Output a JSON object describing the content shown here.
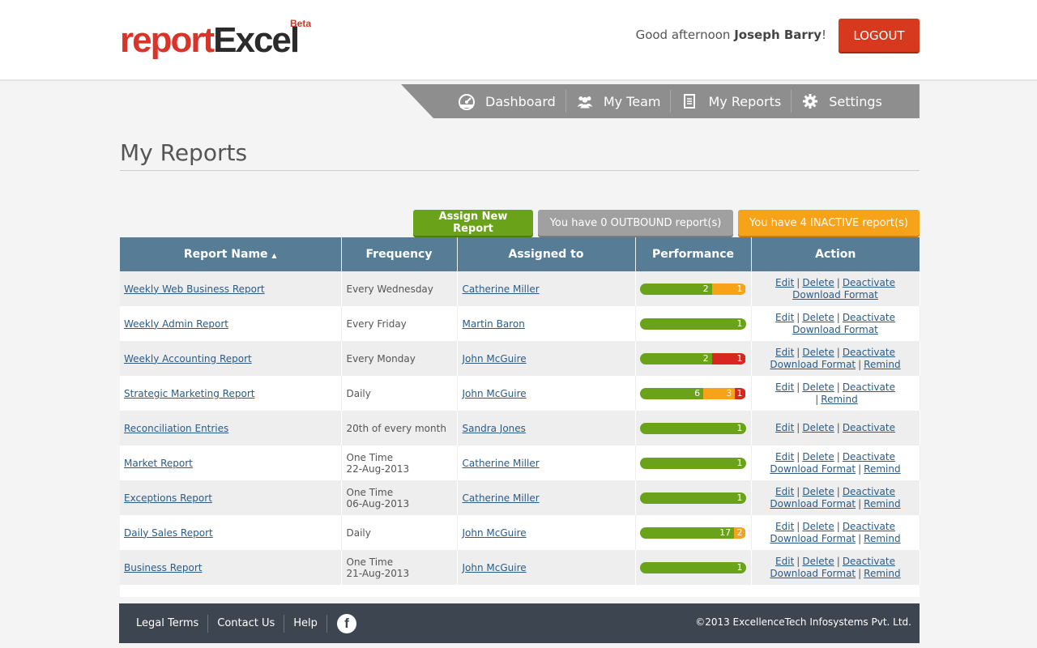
{
  "brand": {
    "part1": "report",
    "part2": "Excel",
    "beta": "Beta"
  },
  "header": {
    "greeting_prefix": "Good afternoon ",
    "user_name": "Joseph Barry",
    "greeting_suffix": "!",
    "logout_label": "LOGOUT"
  },
  "nav": [
    {
      "label": "Dashboard",
      "icon": "speedometer-icon"
    },
    {
      "label": "My Team",
      "icon": "team-icon"
    },
    {
      "label": "My Reports",
      "icon": "reports-icon"
    },
    {
      "label": "Settings",
      "icon": "gear-icon"
    }
  ],
  "page": {
    "title": "My Reports"
  },
  "buttons": {
    "assign": "Assign New Report",
    "outbound": "You have 0 OUTBOUND report(s)",
    "inactive": "You have 4 INACTIVE report(s)"
  },
  "table": {
    "headers": {
      "name": "Report Name",
      "sort_arrow": "▲",
      "frequency": "Frequency",
      "assigned": "Assigned to",
      "performance": "Performance",
      "action": "Action"
    },
    "rows": [
      {
        "name": "Weekly Web Business Report",
        "freq1": "Every Wednesday",
        "freq2": "",
        "assigned": "Catherine Miller",
        "perf": [
          {
            "c": "g",
            "v": "2",
            "w": 68
          },
          {
            "c": "o",
            "v": "1",
            "w": 32
          }
        ],
        "actions": [
          [
            "Edit",
            "Delete",
            "Deactivate"
          ],
          [
            "Download Format"
          ]
        ]
      },
      {
        "name": "Weekly Admin Report",
        "freq1": "Every Friday",
        "freq2": "",
        "assigned": "Martin Baron",
        "perf": [
          {
            "c": "g",
            "v": "1",
            "w": 100
          }
        ],
        "actions": [
          [
            "Edit",
            "Delete",
            "Deactivate"
          ],
          [
            "Download Format"
          ]
        ]
      },
      {
        "name": "Weekly Accounting Report",
        "freq1": "Every Monday",
        "freq2": "",
        "assigned": "John McGuire",
        "perf": [
          {
            "c": "g",
            "v": "2",
            "w": 68
          },
          {
            "c": "r",
            "v": "1",
            "w": 32
          }
        ],
        "actions": [
          [
            "Edit",
            "Delete",
            "Deactivate"
          ],
          [
            "Download Format",
            "Remind"
          ]
        ]
      },
      {
        "name": "Strategic Marketing Report",
        "freq1": "Daily",
        "freq2": "",
        "assigned": "John McGuire",
        "perf": [
          {
            "c": "g",
            "v": "6",
            "w": 60
          },
          {
            "c": "o",
            "v": "3",
            "w": 30
          },
          {
            "c": "r",
            "v": "1",
            "w": 10
          }
        ],
        "actions": [
          [
            "Edit",
            "Delete",
            "Deactivate ",
            "Remind"
          ]
        ]
      },
      {
        "name": "Reconciliation Entries",
        "freq1": "20th of every month",
        "freq2": "",
        "assigned": "Sandra Jones",
        "perf": [
          {
            "c": "g",
            "v": "1",
            "w": 100
          }
        ],
        "actions": [
          [
            "Edit",
            "Delete",
            "Deactivate"
          ]
        ]
      },
      {
        "name": "Market Report",
        "freq1": "One Time",
        "freq2": "22-Aug-2013",
        "assigned": "Catherine Miller",
        "perf": [
          {
            "c": "g",
            "v": "1",
            "w": 100
          }
        ],
        "actions": [
          [
            "Edit",
            "Delete",
            "Deactivate"
          ],
          [
            "Download Format",
            "Remind"
          ]
        ]
      },
      {
        "name": "Exceptions Report",
        "freq1": "One Time",
        "freq2": "06-Aug-2013",
        "assigned": "Catherine Miller",
        "perf": [
          {
            "c": "g",
            "v": "1",
            "w": 100
          }
        ],
        "actions": [
          [
            "Edit",
            "Delete",
            "Deactivate"
          ],
          [
            "Download Format",
            "Remind"
          ]
        ]
      },
      {
        "name": "Daily Sales Report",
        "freq1": "Daily",
        "freq2": "",
        "assigned": "John McGuire",
        "perf": [
          {
            "c": "g",
            "v": "17",
            "w": 89
          },
          {
            "c": "o",
            "v": "2",
            "w": 11
          }
        ],
        "actions": [
          [
            "Edit",
            "Delete",
            "Deactivate"
          ],
          [
            "Download Format",
            "Remind"
          ]
        ]
      },
      {
        "name": "Business Report",
        "freq1": "One Time",
        "freq2": "21-Aug-2013",
        "assigned": "John McGuire",
        "perf": [
          {
            "c": "g",
            "v": "1",
            "w": 100
          }
        ],
        "actions": [
          [
            "Edit",
            "Delete",
            "Deactivate"
          ],
          [
            "Download Format",
            "Remind"
          ]
        ]
      }
    ]
  },
  "footer": {
    "links": [
      "Legal Terms",
      "Contact Us",
      "Help"
    ],
    "social_icon": "facebook-icon",
    "social_glyph": "f",
    "copyright": "©2013 ExcellenceTech Infosystems Pvt. Ltd."
  }
}
